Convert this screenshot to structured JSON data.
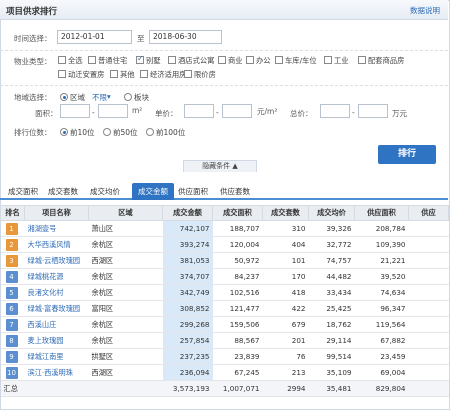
{
  "header": {
    "title": "项目供求排行",
    "help": "数据说明"
  },
  "filters": {
    "time_label": "时间选择：",
    "date_from": "2012-01-01",
    "date_sep": "至",
    "date_to": "2018-06-30",
    "property_label": "物业类型：",
    "property_types": [
      {
        "label": "全选",
        "checked": false
      },
      {
        "label": "普通住宅",
        "checked": false
      },
      {
        "label": "别墅",
        "checked": true
      },
      {
        "label": "酒店式公寓",
        "checked": false
      },
      {
        "label": "商业",
        "checked": false
      },
      {
        "label": "办公",
        "checked": false
      },
      {
        "label": "车库/车位",
        "checked": false
      },
      {
        "label": "工业",
        "checked": false
      },
      {
        "label": "配套商品房",
        "checked": false
      },
      {
        "label": "动迁安置房",
        "checked": false
      },
      {
        "label": "其他",
        "checked": false
      },
      {
        "label": "经济适用房",
        "checked": false
      },
      {
        "label": "限价房",
        "checked": false
      }
    ],
    "region_label": "地域选择：",
    "region_option": "区域",
    "region_value": "不限",
    "block_option": "板块",
    "area_label": "面积：",
    "area_unit": "m²",
    "price_label": "单价：",
    "price_unit": "元/m²",
    "total_label": "总价：",
    "total_unit": "万元",
    "rank_label": "排行位数：",
    "rank_options": [
      {
        "label": "前10位",
        "selected": true
      },
      {
        "label": "前50位",
        "selected": false
      },
      {
        "label": "前100位",
        "selected": false
      }
    ],
    "search_button": "排行",
    "toggle_label": "隐藏条件 ▲"
  },
  "tabs": [
    "成交面积",
    "成交套数",
    "成交均价",
    "成交金额",
    "供应面积",
    "供应套数"
  ],
  "active_tab": 3,
  "table": {
    "columns": [
      "排名",
      "项目名称",
      "区域",
      "成交金额",
      "成交面积",
      "成交套数",
      "成交均价",
      "供应面积",
      "供应"
    ],
    "rows": [
      {
        "rank": "1",
        "name": "湘湖壹号",
        "district": "萧山区",
        "amount": "742,107",
        "area": "188,707",
        "count": "310",
        "avg": "39,326",
        "supply": "208,784"
      },
      {
        "rank": "2",
        "name": "大华西溪风情",
        "district": "余杭区",
        "amount": "393,274",
        "area": "120,004",
        "count": "404",
        "avg": "32,772",
        "supply": "109,390"
      },
      {
        "rank": "3",
        "name": "绿城·云栖玫瑰园",
        "district": "西湖区",
        "amount": "381,053",
        "area": "50,972",
        "count": "101",
        "avg": "74,757",
        "supply": "21,221"
      },
      {
        "rank": "4",
        "name": "绿城桃花源",
        "district": "余杭区",
        "amount": "374,707",
        "area": "84,237",
        "count": "170",
        "avg": "44,482",
        "supply": "39,520"
      },
      {
        "rank": "5",
        "name": "良渚文化村",
        "district": "余杭区",
        "amount": "342,749",
        "area": "102,516",
        "count": "418",
        "avg": "33,434",
        "supply": "74,634"
      },
      {
        "rank": "6",
        "name": "绿城·富春玫瑰园",
        "district": "富阳区",
        "amount": "308,852",
        "area": "121,477",
        "count": "422",
        "avg": "25,425",
        "supply": "96,347"
      },
      {
        "rank": "7",
        "name": "西溪山庄",
        "district": "余杭区",
        "amount": "299,268",
        "area": "159,506",
        "count": "679",
        "avg": "18,762",
        "supply": "119,564"
      },
      {
        "rank": "8",
        "name": "麦上玫瑰园",
        "district": "余杭区",
        "amount": "257,854",
        "area": "88,567",
        "count": "201",
        "avg": "29,114",
        "supply": "67,882"
      },
      {
        "rank": "9",
        "name": "绿城江南里",
        "district": "拱墅区",
        "amount": "237,235",
        "area": "23,839",
        "count": "76",
        "avg": "99,514",
        "supply": "23,459"
      },
      {
        "rank": "10",
        "name": "滨江·西溪明珠",
        "district": "西湖区",
        "amount": "236,094",
        "area": "67,245",
        "count": "213",
        "avg": "35,109",
        "supply": "69,004"
      }
    ],
    "total": {
      "label": "汇总",
      "amount": "3,573,193",
      "area": "1,007,071",
      "count": "2994",
      "avg": "35,481",
      "supply": "829,804"
    }
  },
  "colors": {
    "rank_top3": "#e8973a",
    "rank_rest": "#5b8fcf",
    "accent": "#2f73c3",
    "highlight": "#d9e9f8"
  }
}
